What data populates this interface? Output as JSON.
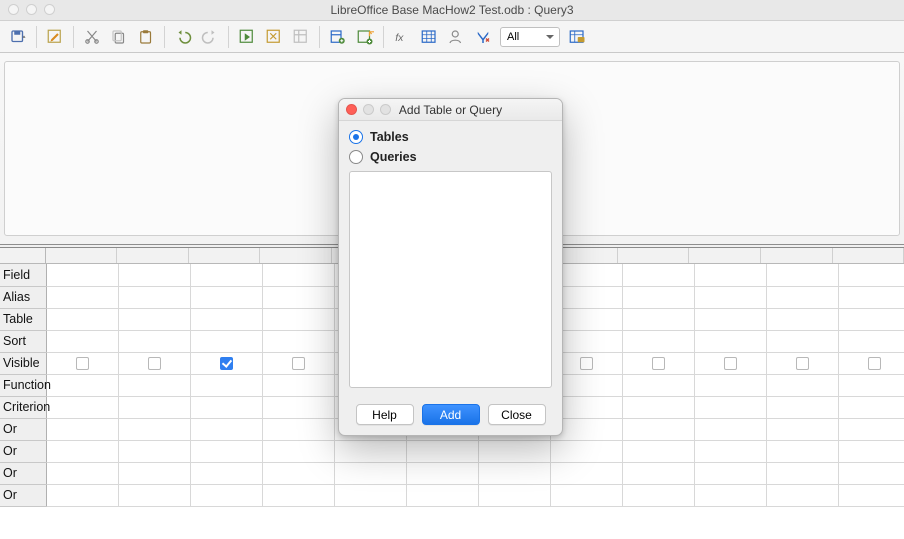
{
  "window": {
    "title": "LibreOffice Base MacHow2 Test.odb : Query3"
  },
  "toolbar": {
    "filter_select": "All"
  },
  "grid": {
    "row_labels": [
      "Field",
      "Alias",
      "Table",
      "Sort",
      "Visible",
      "Function",
      "Criterion",
      "Or",
      "Or",
      "Or",
      "Or"
    ],
    "columns": 12,
    "visible_checks": [
      false,
      false,
      true,
      false,
      false,
      false,
      false,
      false,
      false,
      false,
      false,
      false
    ]
  },
  "dialog": {
    "title": "Add Table or Query",
    "radio_tables": "Tables",
    "radio_queries": "Queries",
    "selected_radio": "tables",
    "buttons": {
      "help": "Help",
      "add": "Add",
      "close": "Close"
    }
  }
}
